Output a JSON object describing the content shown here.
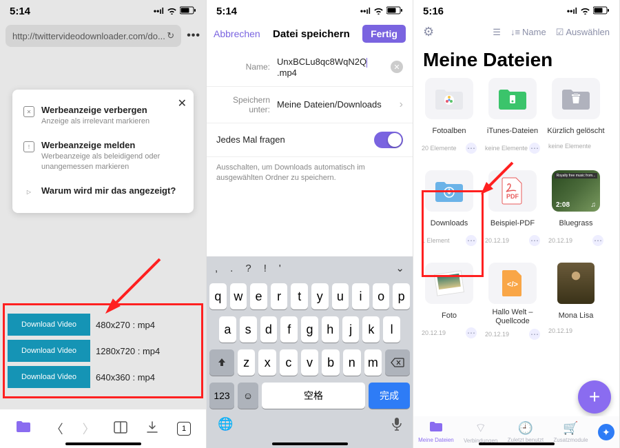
{
  "panel1": {
    "time": "5:14",
    "url": "http://twittervideodownloader.com/do...",
    "ad_popup": {
      "items": [
        {
          "icon": "✕",
          "title": "Werbeanzeige verbergen",
          "sub": "Anzeige als irrelevant markieren"
        },
        {
          "icon": "!",
          "title": "Werbeanzeige melden",
          "sub": "Werbeanzeige als beleidigend oder unangemessen markieren"
        },
        {
          "icon": "▷",
          "title": "Warum wird mir das angezeigt?",
          "sub": ""
        }
      ]
    },
    "downloads": [
      {
        "btn": "Download Video",
        "fmt": "480x270 : mp4"
      },
      {
        "btn": "Download Video",
        "fmt": "1280x720 : mp4"
      },
      {
        "btn": "Download Video",
        "fmt": "640x360 : mp4"
      }
    ],
    "tab_count": "1"
  },
  "panel2": {
    "time": "5:14",
    "cancel": "Abbrechen",
    "title": "Datei speichern",
    "done": "Fertig",
    "name_label": "Name:",
    "name_value_pre": "UnxBCLu8qc8WqN2Q",
    "name_value_ext": ".mp4",
    "save_label": "Speichern unter:",
    "save_value": "Meine Dateien/Downloads",
    "ask_label": "Jedes Mal fragen",
    "hint": "Ausschalten, um Downloads automatisch im ausgewählten Ordner zu speichern.",
    "keyboard": {
      "punct": [
        ",",
        ".",
        "?",
        "!",
        "'"
      ],
      "row1": [
        "q",
        "w",
        "e",
        "r",
        "t",
        "y",
        "u",
        "i",
        "o",
        "p"
      ],
      "row2": [
        "a",
        "s",
        "d",
        "f",
        "g",
        "h",
        "j",
        "k",
        "l"
      ],
      "row3": [
        "z",
        "x",
        "c",
        "v",
        "b",
        "n",
        "m"
      ],
      "num_key": "123",
      "space": "空格",
      "confirm": "完成"
    }
  },
  "panel3": {
    "time": "5:16",
    "sort_label": "Name",
    "select_label": "Auswählen",
    "title": "Meine Dateien",
    "tiles": [
      {
        "name": "Fotoalben",
        "meta": "20 Elemente",
        "type": "photos"
      },
      {
        "name": "iTunes-Dateien",
        "meta": "keine Elemente",
        "type": "itunes"
      },
      {
        "name": "Kürzlich gelöscht",
        "meta": "keine Elemente",
        "type": "trash"
      },
      {
        "name": "Downloads",
        "meta": "1 Element",
        "type": "downloads"
      },
      {
        "name": "Beispiel-PDF",
        "meta": "20.12.19",
        "type": "pdf"
      },
      {
        "name": "Bluegrass",
        "meta": "20.12.19",
        "type": "video",
        "duration": "2:08"
      },
      {
        "name": "Foto",
        "meta": "20.12.19",
        "type": "photo"
      },
      {
        "name": "Hallo Welt – Quellcode",
        "meta": "20.12.19",
        "type": "code"
      },
      {
        "name": "Mona Lisa",
        "meta": "20.12.19",
        "type": "image"
      }
    ],
    "tabs": [
      {
        "label": "Meine Dateien",
        "active": true
      },
      {
        "label": "Verbindungen"
      },
      {
        "label": "Zuletzt benutzt"
      },
      {
        "label": "Zusatzmodule"
      }
    ]
  }
}
